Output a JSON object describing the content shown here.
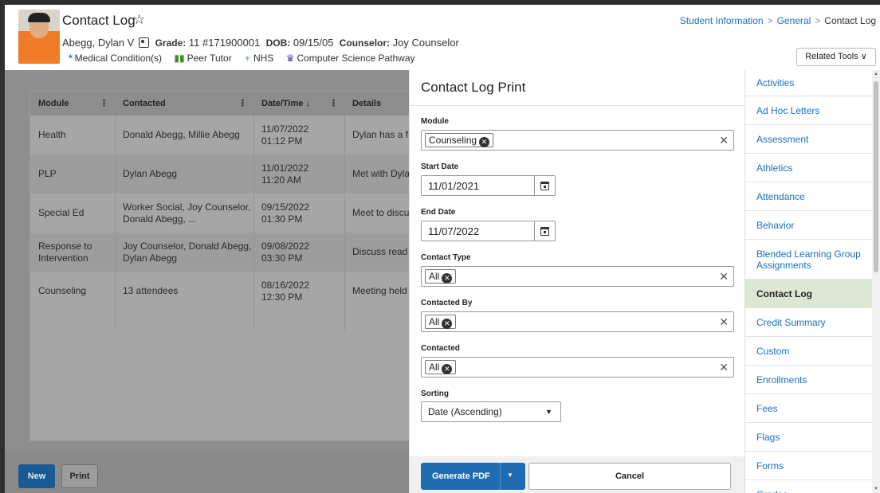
{
  "header": {
    "title": "Contact Log",
    "student_name": "Abegg, Dylan V",
    "grade_label": "Grade:",
    "grade_value": "11 #171900001",
    "dob_label": "DOB:",
    "dob_value": "09/15/05",
    "counselor_label": "Counselor:",
    "counselor_value": "Joy Counselor",
    "flags": [
      {
        "icon": "*",
        "label": "Medical Condition(s)"
      },
      {
        "icon": "▮▮",
        "label": "Peer Tutor"
      },
      {
        "icon": "♆",
        "label": "NHS"
      },
      {
        "icon": "♛",
        "label": "Computer Science Pathway"
      }
    ],
    "breadcrumb": [
      "Student Information",
      "General",
      "Contact Log"
    ],
    "related_tools": "Related Tools ∨"
  },
  "grid": {
    "columns": [
      "Module",
      "Contacted",
      "Date/Time ↓",
      "Details"
    ],
    "rows": [
      {
        "module": "Health",
        "contacted": "Donald Abegg, Millie Abegg",
        "date": "11/07/2022",
        "time": "01:12 PM",
        "details": "Dylan has a f"
      },
      {
        "module": "PLP",
        "contacted": "Dylan Abegg",
        "date": "11/01/2022",
        "time": "11:20 AM",
        "details": "Met with Dyla"
      },
      {
        "module": "Special Ed",
        "contacted": "Worker Social, Joy Counselor, Donald Abegg, ...",
        "date": "09/15/2022",
        "time": "01:30 PM",
        "details": "Meet to discu"
      },
      {
        "module": "Response to Intervention",
        "contacted": "Joy Counselor, Donald Abegg, Dylan Abegg",
        "date": "09/08/2022",
        "time": "03:30 PM",
        "details": "Discuss read"
      },
      {
        "module": "Counseling",
        "contacted": "13 attendees",
        "date": "08/16/2022",
        "time": "12:30 PM",
        "details": "Meeting held"
      }
    ],
    "buttons": {
      "new": "New",
      "print": "Print"
    }
  },
  "print_panel": {
    "title": "Contact Log Print",
    "module_label": "Module",
    "module_value": "Counseling",
    "start_date_label": "Start Date",
    "start_date_value": "11/01/2021",
    "end_date_label": "End Date",
    "end_date_value": "11/07/2022",
    "contact_type_label": "Contact Type",
    "contact_type_value": "All",
    "contacted_by_label": "Contacted By",
    "contacted_by_value": "All",
    "contacted_label": "Contacted",
    "contacted_value": "All",
    "sorting_label": "Sorting",
    "sorting_value": "Date (Ascending)",
    "generate_pdf": "Generate PDF",
    "cancel": "Cancel"
  },
  "nav": {
    "items": [
      "Activities",
      "Ad Hoc Letters",
      "Assessment",
      "Athletics",
      "Attendance",
      "Behavior",
      "Blended Learning Group Assignments",
      "Contact Log",
      "Credit Summary",
      "Custom",
      "Enrollments",
      "Fees",
      "Flags",
      "Forms",
      "Grades"
    ],
    "active": "Contact Log"
  },
  "colors": {
    "accent": "#1f6cb0",
    "link": "#1a6fc0",
    "active_nav_bg": "#dde8d4",
    "new_button": "#1a5a93"
  }
}
